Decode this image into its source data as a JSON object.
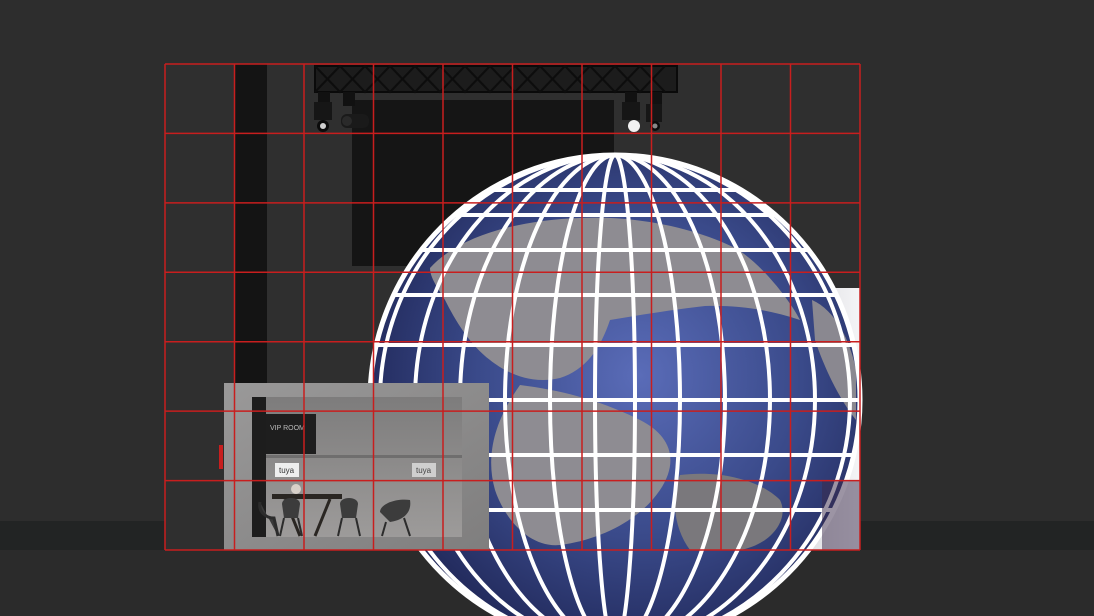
{
  "scene": {
    "type": "3D booth render elevation with red grid overlay",
    "grid": {
      "columns": 10,
      "rows": 7,
      "line_color": "#c81e1e"
    },
    "colors": {
      "background": "#2d2d2d",
      "floor": "#1f2121",
      "dark_wall": "#1a1a1a",
      "globe_wireframe": "#ffffff",
      "globe_ocean": "#3a4a8a",
      "land": "#8e8c92",
      "vip_room_panel": "#8c8b8b"
    },
    "vip_room": {
      "sign": "VIP ROOM",
      "logo_left": "tuya",
      "logo_right": "tuya"
    },
    "icons": [
      "spotlight-icon",
      "truss-icon",
      "chair-icon"
    ]
  }
}
